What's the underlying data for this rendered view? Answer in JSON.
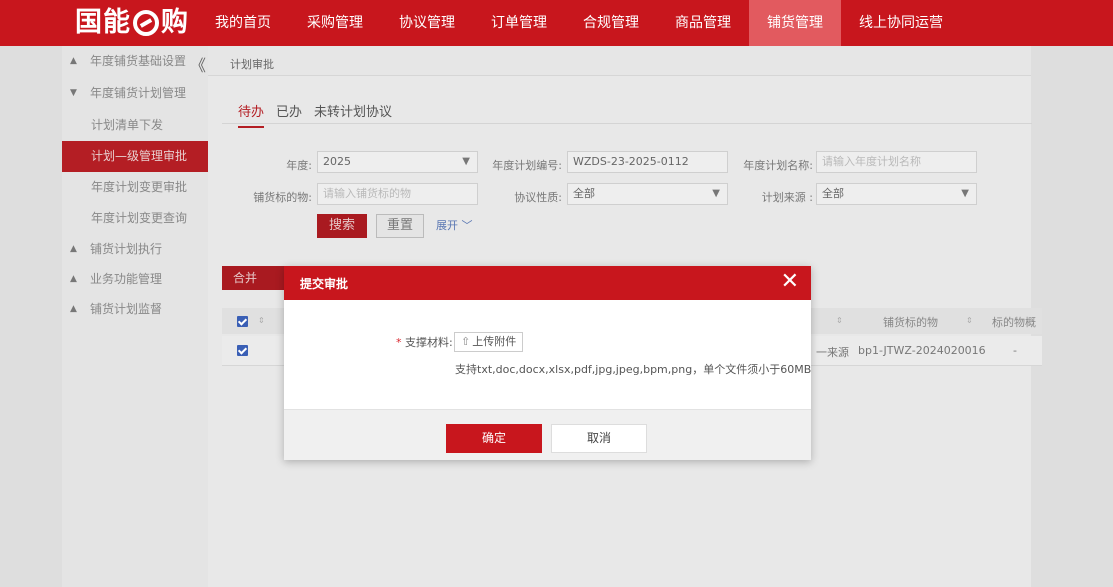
{
  "header": {
    "logo_text_1": "国能",
    "logo_text_2": "购",
    "nav": [
      "我的首页",
      "采购管理",
      "协议管理",
      "订单管理",
      "合规管理",
      "商品管理",
      "铺货管理",
      "线上协同运营"
    ],
    "active_nav_index": 6,
    "active_color": "#c8161d"
  },
  "sidebar": {
    "collapse_glyph": "《",
    "groups": [
      {
        "label": "年度铺货基础设置",
        "open": false
      },
      {
        "label": "年度铺货计划管理",
        "open": true,
        "items": [
          "计划清单下发",
          "计划—级管理审批",
          "年度计划变更审批",
          "年度计划变更查询"
        ],
        "active_item": 1
      },
      {
        "label": "铺货计划执行",
        "open": false
      },
      {
        "label": "业务功能管理",
        "open": false
      },
      {
        "label": "铺货计划监督",
        "open": false
      }
    ]
  },
  "breadcrumb": "计划审批",
  "tabs": [
    "待办",
    "已办",
    "未转计划协议"
  ],
  "filters": {
    "year_label": "年度:",
    "year_value": "2025",
    "plan_no_label": "年度计划编号:",
    "plan_no_value": "WZDS-23-2025-0112",
    "plan_name_label": "年度计划名称:",
    "plan_name_placeholder": "请输入年度计划名称",
    "target_label": "铺货标的物:",
    "target_placeholder": "请输入铺货标的物",
    "nature_label": "协议性质:",
    "nature_value": "全部",
    "source_label": "计划来源 :",
    "source_value": "全部",
    "search_label": "搜索",
    "reset_label": "重置",
    "expand_label": "展开"
  },
  "toolbar": {
    "merge_label": "合并"
  },
  "table": {
    "headers": [
      "铺货标的物",
      "标的物概"
    ],
    "row": {
      "source": "一来源",
      "target": "bp1-JTWZ-2024020016",
      "summary": "-"
    }
  },
  "modal": {
    "title": "提交审批",
    "close_glyph": "✕",
    "required_mark": "*",
    "material_label": "支撑材料:",
    "upload_label": "上传附件",
    "hint": "支持txt,doc,docx,xlsx,pdf,jpg,jpeg,bpm,png，单个文件须小于60MB",
    "ok_label": "确定",
    "cancel_label": "取消"
  }
}
